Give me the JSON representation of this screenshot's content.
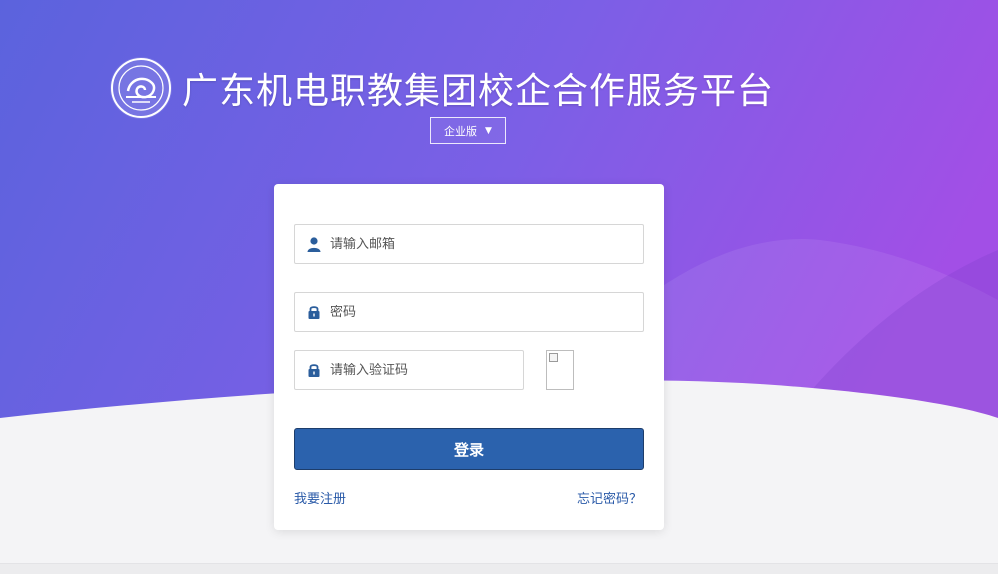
{
  "header": {
    "title": "广东机电职教集团校企合作服务平台",
    "logo_icon": "school-seal-logo"
  },
  "version_select": {
    "selected": "企业版"
  },
  "login_form": {
    "email_placeholder": "请输入邮箱",
    "password_placeholder": "密码",
    "captcha_placeholder": "请输入验证码",
    "login_label": "登录",
    "register_label": "我要注册",
    "forgot_label": "忘记密码？"
  },
  "colors": {
    "gradient_start": "#5b63dd",
    "gradient_end": "#a24fe6",
    "button": "#2b62ad",
    "link": "#2a5aa8"
  }
}
